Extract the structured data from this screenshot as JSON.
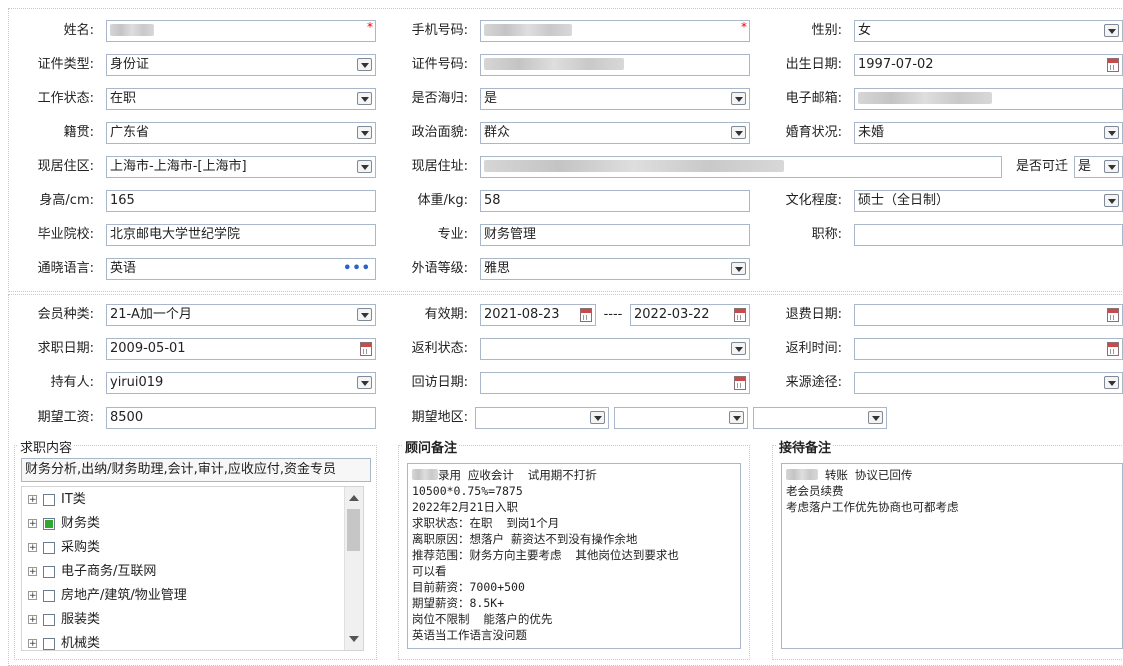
{
  "basic": {
    "name_label": "姓名:",
    "mobile_label": "手机号码:",
    "gender_label": "性别:",
    "gender_value": "女",
    "id_type_label": "证件类型:",
    "id_type_value": "身份证",
    "id_no_label": "证件号码:",
    "birth_label": "出生日期:",
    "birth_value": "1997-07-02",
    "work_status_label": "工作状态:",
    "work_status_value": "在职",
    "returnee_label": "是否海归:",
    "returnee_value": "是",
    "email_label": "电子邮箱:",
    "native_label": "籍贯:",
    "native_value": "广东省",
    "political_label": "政治面貌:",
    "political_value": "群众",
    "marital_label": "婚育状况:",
    "marital_value": "未婚",
    "residence_area_label": "现居住区:",
    "residence_area_value": "上海市-上海市-[上海市]",
    "address_label": "现居住址:",
    "relocate_label": "是否可迁",
    "relocate_value": "是",
    "height_label": "身高/cm:",
    "height_value": "165",
    "weight_label": "体重/kg:",
    "weight_value": "58",
    "education_label": "文化程度:",
    "education_value": "硕士（全日制）",
    "school_label": "毕业院校:",
    "school_value": "北京邮电大学世纪学院",
    "major_label": "专业:",
    "major_value": "财务管理",
    "title_label": "职称:",
    "title_value": "",
    "language_label": "通晓语言:",
    "language_value": "英语",
    "foreign_level_label": "外语等级:",
    "foreign_level_value": "雅思",
    "required_mark": "*",
    "more_glyph": "•••"
  },
  "membership": {
    "type_label": "会员种类:",
    "type_value": "21-A加一个月",
    "valid_label": "有效期:",
    "valid_from": "2021-08-23",
    "valid_sep": "----",
    "valid_to": "2022-03-22",
    "refund_date_label": "退费日期:",
    "refund_date_value": "",
    "job_date_label": "求职日期:",
    "job_date_value": "2009-05-01",
    "rebate_status_label": "返利状态:",
    "rebate_status_value": "",
    "rebate_time_label": "返利时间:",
    "rebate_time_value": "",
    "holder_label": "持有人:",
    "holder_value": "yirui019",
    "visit_date_label": "回访日期:",
    "visit_date_value": "",
    "source_label": "来源途径:",
    "source_value": "",
    "salary_label": "期望工资:",
    "salary_value": "8500",
    "region_label": "期望地区:"
  },
  "job_content": {
    "title": "求职内容",
    "summary": "财务分析,出纳/财务助理,会计,审计,应收应付,资金专员",
    "tree": [
      {
        "label": "IT类",
        "checked": false
      },
      {
        "label": "财务类",
        "checked": true
      },
      {
        "label": "采购类",
        "checked": false
      },
      {
        "label": "电子商务/互联网",
        "checked": false
      },
      {
        "label": "房地产/建筑/物业管理",
        "checked": false
      },
      {
        "label": "服装类",
        "checked": false
      },
      {
        "label": "机械类",
        "checked": false
      }
    ]
  },
  "consultant_notes": {
    "title": "顾问备注",
    "line1_suffix": "录用 应收会计  试用期不打折",
    "lines": "10500*0.75%=7875\n2022年2月21日入职\n求职状态：在职  到岗1个月\n离职原因：想落户 薪资达不到没有操作余地\n推荐范围：财务方向主要考虑  其他岗位达到要求也\n可以看\n目前薪资：7000+500\n期望薪资：8.5K+\n岗位不限制  能落户的优先\n英语当工作语言没问题"
  },
  "reception_notes": {
    "title": "接待备注",
    "line1_suffix": " 转账 协议已回传",
    "lines": "老会员续费\n考虑落户工作优先协商也可都考虑"
  }
}
